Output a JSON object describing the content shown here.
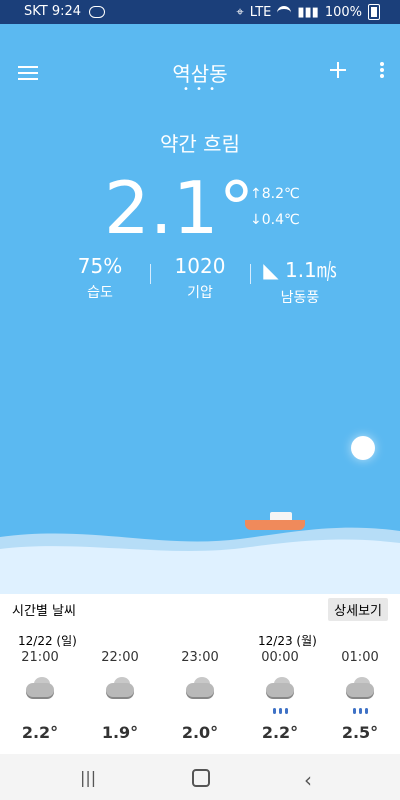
{
  "status": {
    "carrier_time": "SKT 9:24",
    "battery": "100%",
    "volte": "LTE"
  },
  "toolbar": {
    "title": "역삼동",
    "dots": "• • •"
  },
  "current": {
    "condition": "약간 흐림",
    "temp": "2.1°",
    "high": "↑8.2℃",
    "low": "↓0.4℃",
    "humidity_value": "75%",
    "humidity_label": "습도",
    "pressure_value": "1020",
    "pressure_label": "기압",
    "wind_value": "1.1㎧",
    "wind_label": "남동풍"
  },
  "hourly": {
    "header": "시간별 날씨",
    "detail_button": "상세보기",
    "dates": [
      "12/22 (일)",
      "12/23 (월)"
    ],
    "items": [
      {
        "time": "21:00",
        "temp": "2.2°",
        "icon": "cloud-icon"
      },
      {
        "time": "22:00",
        "temp": "1.9°",
        "icon": "cloud-icon"
      },
      {
        "time": "23:00",
        "temp": "2.0°",
        "icon": "cloud-icon"
      },
      {
        "time": "00:00",
        "temp": "2.2°",
        "icon": "rain-cloud-icon"
      },
      {
        "time": "01:00",
        "temp": "2.5°",
        "icon": "rain-cloud-icon"
      }
    ]
  },
  "colors": {
    "sky": "#5bb9f1",
    "statusbar": "#1b3f7a",
    "boat": "#f08a5b"
  }
}
